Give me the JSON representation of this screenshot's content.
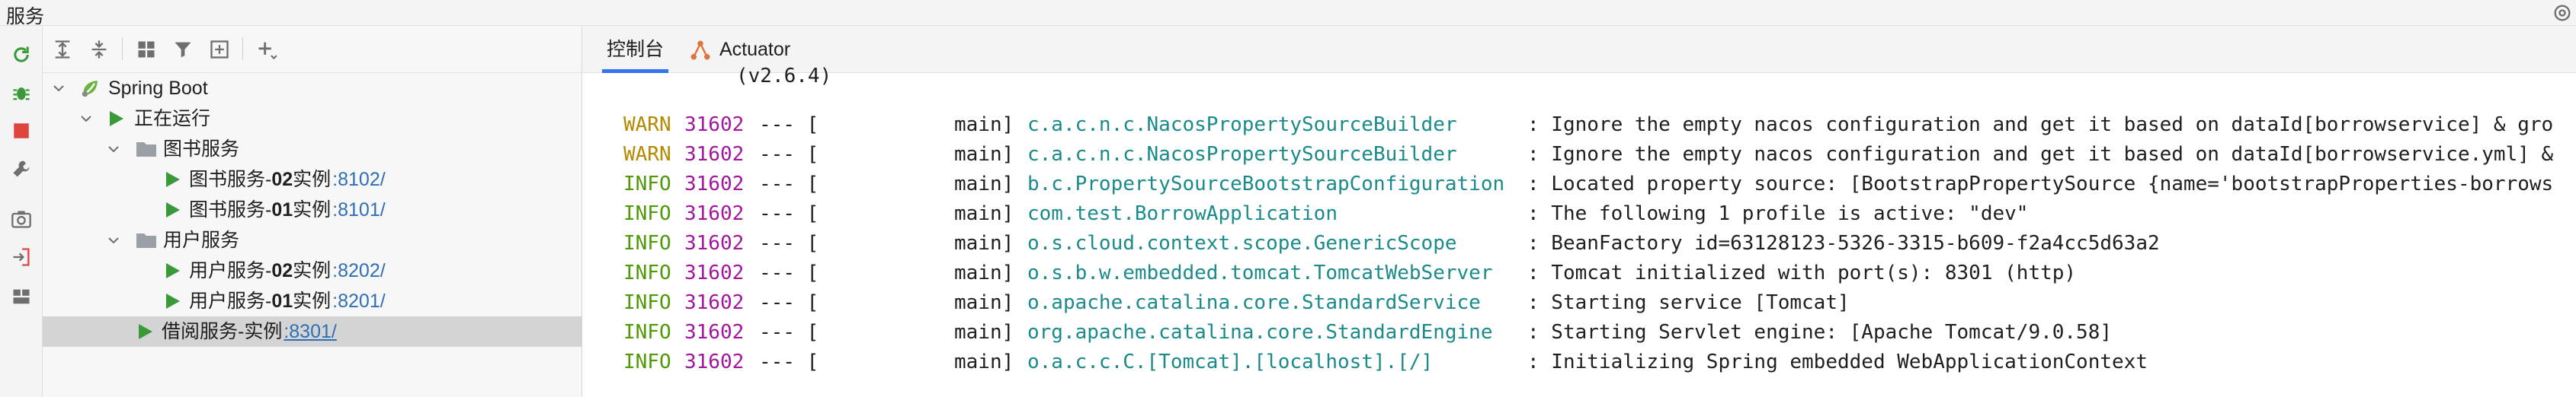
{
  "window": {
    "title": "服务"
  },
  "tree_toolbar": {
    "icons": [
      "expand-all-icon",
      "collapse-all-icon",
      "group-icon",
      "filter-icon",
      "new-tab-icon",
      "add-icon"
    ]
  },
  "tree": {
    "root": {
      "label": "Spring Boot"
    },
    "running": {
      "label": "正在运行"
    },
    "groups": [
      {
        "label": "图书服务",
        "items": [
          {
            "prefix": "图书服务-",
            "bold": "02",
            "suffix": "实例",
            "port": ":8102/"
          },
          {
            "prefix": "图书服务-",
            "bold": "01",
            "suffix": "实例",
            "port": ":8101/"
          }
        ]
      },
      {
        "label": "用户服务",
        "items": [
          {
            "prefix": "用户服务-",
            "bold": "02",
            "suffix": "实例",
            "port": ":8202/"
          },
          {
            "prefix": "用户服务-",
            "bold": "01",
            "suffix": "实例",
            "port": ":8201/"
          }
        ]
      }
    ],
    "selected": {
      "label": "借阅服务-实例",
      "port": ":8301/"
    }
  },
  "console": {
    "tabs": [
      {
        "label": "控制台",
        "active": true
      },
      {
        "label": "Actuator",
        "active": false
      }
    ],
    "banner_version": "(v2.6.4)",
    "lines": [
      {
        "level": "WARN",
        "pid": "31602",
        "sep": "--- [",
        "thread": "main]",
        "logger": "c.a.c.n.c.NacosPropertySourceBuilder",
        "message": ": Ignore the empty nacos configuration and get it based on dataId[borrowservice] & gro"
      },
      {
        "level": "WARN",
        "pid": "31602",
        "sep": "--- [",
        "thread": "main]",
        "logger": "c.a.c.n.c.NacosPropertySourceBuilder",
        "message": ": Ignore the empty nacos configuration and get it based on dataId[borrowservice.yml] &"
      },
      {
        "level": "INFO",
        "pid": "31602",
        "sep": "--- [",
        "thread": "main]",
        "logger": "b.c.PropertySourceBootstrapConfiguration",
        "message": ": Located property source: [BootstrapPropertySource {name='bootstrapProperties-borrows"
      },
      {
        "level": "INFO",
        "pid": "31602",
        "sep": "--- [",
        "thread": "main]",
        "logger": "com.test.BorrowApplication",
        "message": ": The following 1 profile is active: \"dev\""
      },
      {
        "level": "INFO",
        "pid": "31602",
        "sep": "--- [",
        "thread": "main]",
        "logger": "o.s.cloud.context.scope.GenericScope",
        "message": ": BeanFactory id=63128123-5326-3315-b609-f2a4cc5d63a2"
      },
      {
        "level": "INFO",
        "pid": "31602",
        "sep": "--- [",
        "thread": "main]",
        "logger": "o.s.b.w.embedded.tomcat.TomcatWebServer",
        "message": ": Tomcat initialized with port(s): 8301 (http)"
      },
      {
        "level": "INFO",
        "pid": "31602",
        "sep": "--- [",
        "thread": "main]",
        "logger": "o.apache.catalina.core.StandardService",
        "message": ": Starting service [Tomcat]"
      },
      {
        "level": "INFO",
        "pid": "31602",
        "sep": "--- [",
        "thread": "main]",
        "logger": "org.apache.catalina.core.StandardEngine",
        "message": ": Starting Servlet engine: [Apache Tomcat/9.0.58]"
      },
      {
        "level": "INFO",
        "pid": "31602",
        "sep": "--- [",
        "thread": "main]",
        "logger": "o.a.c.c.C.[Tomcat].[localhost].[/]",
        "message": ": Initializing Spring embedded WebApplicationContext"
      }
    ]
  },
  "colors": {
    "warn": "#b58900",
    "info": "#4e9a06",
    "pid": "#a3159e",
    "logger": "#1a8a8a",
    "run": "#3a9a3a",
    "port": "#2f6fb6",
    "stop": "#e0443e",
    "selection": "#d4d4d4",
    "tab_underline": "#3574f0"
  }
}
